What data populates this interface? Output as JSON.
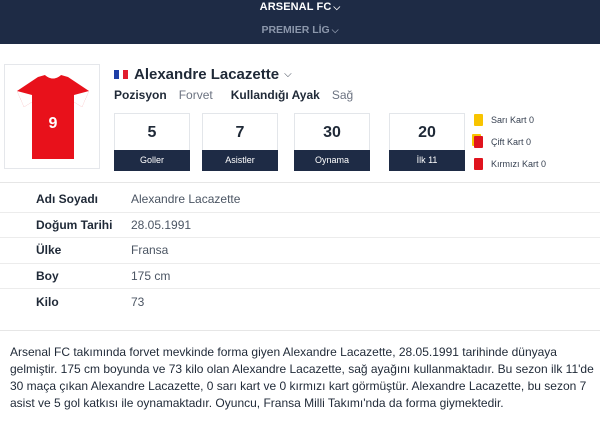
{
  "header": {
    "team": "ARSENAL FC",
    "team_chevron_icon": "chevron-down-icon",
    "league": "PREMIER LİG",
    "league_chevron_icon": "chevron-down-icon"
  },
  "player": {
    "jersey_number": "9",
    "name": "Alexandre Lacazette",
    "flag_icon": "france-flag-icon",
    "position_label": "Pozisyon",
    "position_value": "Forvet",
    "foot_label": "Kullandığı Ayak",
    "foot_value": "Sağ"
  },
  "stats": [
    {
      "value": "5",
      "label": "Goller"
    },
    {
      "value": "7",
      "label": "Asistler"
    },
    {
      "value": "30",
      "label": "Oynama"
    },
    {
      "value": "20",
      "label": "İlk 11"
    }
  ],
  "cards": [
    {
      "label": "Sarı Kart 0",
      "icon": "yellow-card-icon"
    },
    {
      "label": "Çift Kart 0",
      "icon": "double-card-icon"
    },
    {
      "label": "Kırmızı Kart 0",
      "icon": "red-card-icon"
    }
  ],
  "info": [
    {
      "label": "Adı Soyadı",
      "value": "Alexandre Lacazette"
    },
    {
      "label": "Doğum Tarihi",
      "value": "28.05.1991"
    },
    {
      "label": "Ülke",
      "value": "Fransa"
    },
    {
      "label": "Boy",
      "value": "175 cm"
    },
    {
      "label": "Kilo",
      "value": "73"
    }
  ],
  "description": "Arsenal FC takımında forvet mevkinde forma giyen Alexandre Lacazette, 28.05.1991 tarihinde dünyaya gelmiştir. 175 cm boyunda ve 73 kilo olan Alexandre Lacazette, sağ ayağını kullanmaktadır. Bu sezon ilk 11'de 30 maça çıkan Alexandre Lacazette, 0 sarı kart ve 0 kırmızı kart görmüştür. Alexandre Lacazette, bu sezon 7 asist ve 5 gol katkısı ile oynamaktadır. Oyuncu, Fransa Milli Takımı'nda da forma giymektedir.",
  "colors": {
    "navy": "#1e2b45",
    "jersey_red": "#e8111b",
    "yellow_card": "#f8c400",
    "red_card": "#e0141e"
  }
}
